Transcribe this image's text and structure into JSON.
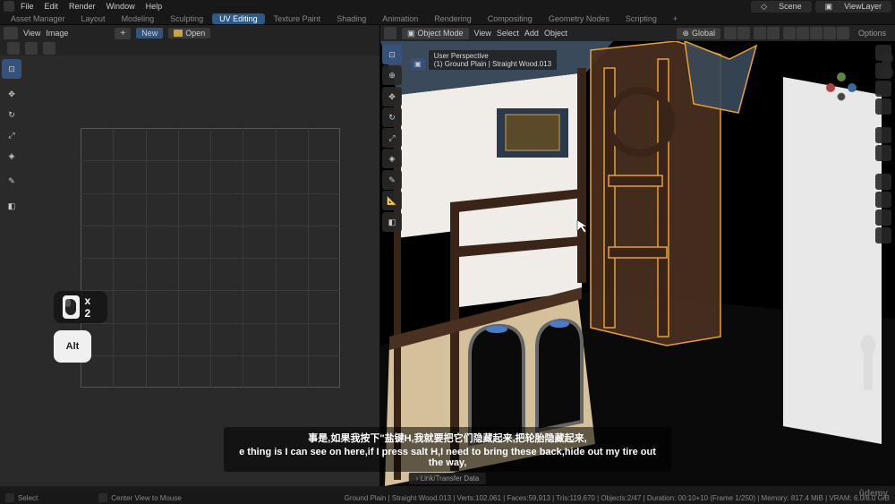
{
  "top_menu": {
    "items": [
      "File",
      "Edit",
      "Render",
      "Window",
      "Help"
    ],
    "scene_label": "Scene",
    "viewlayer_label": "ViewLayer"
  },
  "workspace_tabs": {
    "items": [
      "Asset Manager",
      "Layout",
      "Modeling",
      "Sculpting",
      "UV Editing",
      "Texture Paint",
      "Shading",
      "Animation",
      "Rendering",
      "Compositing",
      "Geometry Nodes",
      "Scripting"
    ],
    "active": "UV Editing",
    "add": "+"
  },
  "uv_editor": {
    "header": {
      "view": "View",
      "image": "Image",
      "new": "New",
      "open": "Open"
    }
  },
  "viewport": {
    "header": {
      "mode": "Object Mode",
      "menu": [
        "View",
        "Select",
        "Add",
        "Object"
      ],
      "orientation": "Global",
      "options": "Options"
    },
    "overlay": {
      "perspective": "User Perspective",
      "object_info": "(1) Ground Plain | Straight Wood.013"
    }
  },
  "key_hints": {
    "mouse_mult": "x 2",
    "alt": "Alt"
  },
  "subtitles": {
    "line1": "事是,如果我按下\"盐键H,我就要把它们隐藏起来,把轮胎隐藏起来,",
    "line2": "e thing is I can see on here,if I press salt H,I need to bring these back,hide out my tire out the way,"
  },
  "context_hint": "Link/Transfer Data",
  "status_bar": {
    "select": "Select",
    "center": "Center View to Mouse",
    "stats": "Ground Plain | Straight Wood.013 | Verts:102,061 | Faces:59,913 | Tris:119,670 | Objects:2/47 | Duration: 00:10+10 (Frame 1/250) | Memory: 817.4 MiB | VRAM: 6.0/8.0 GiB"
  },
  "branding": {
    "udemy": "ûdemy"
  }
}
